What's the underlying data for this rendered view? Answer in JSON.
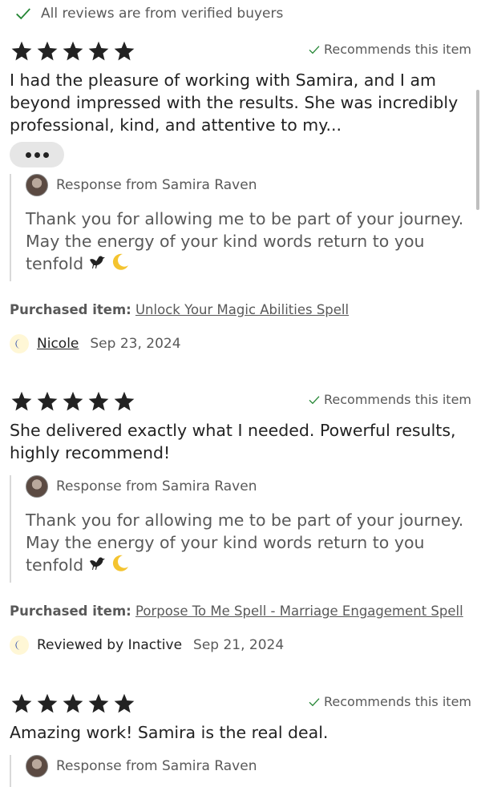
{
  "verified_banner": "All reviews are from verified buyers",
  "colors": {
    "accent_green": "#258635",
    "text_primary": "#222222",
    "text_secondary": "#595959",
    "star": "#222222"
  },
  "reviews": [
    {
      "rating": 5,
      "recommends": "Recommends this item",
      "text": "I had the pleasure of working with Samira, and I am beyond impressed with the results. She was incredibly professional, kind, and attentive to my...",
      "more_icon": "more-dots-icon",
      "response_label": "Response from Samira Raven",
      "response_text": "Thank you for allowing me to be part of your journey. May the energy of your kind words return to you tenfold",
      "purchased_label": "Purchased item:",
      "purchased_item": "Unlock Your Magic Abilities Spell",
      "reviewer": "Nicole",
      "date": "Sep 23, 2024"
    },
    {
      "rating": 5,
      "recommends": "Recommends this item",
      "text": "She delivered exactly what I needed. Powerful results, highly recommend!",
      "response_label": "Response from Samira Raven",
      "response_text": "Thank you for allowing me to be part of your journey. May the energy of your kind words return to you tenfold",
      "purchased_label": "Purchased item:",
      "purchased_item": "Porpose To Me Spell - Marriage Engagement Spell",
      "reviewer": "Reviewed by Inactive",
      "date": "Sep 21, 2024"
    },
    {
      "rating": 5,
      "recommends": "Recommends this item",
      "text": "Amazing work! Samira is the real deal.",
      "response_label": "Response from Samira Raven"
    }
  ]
}
